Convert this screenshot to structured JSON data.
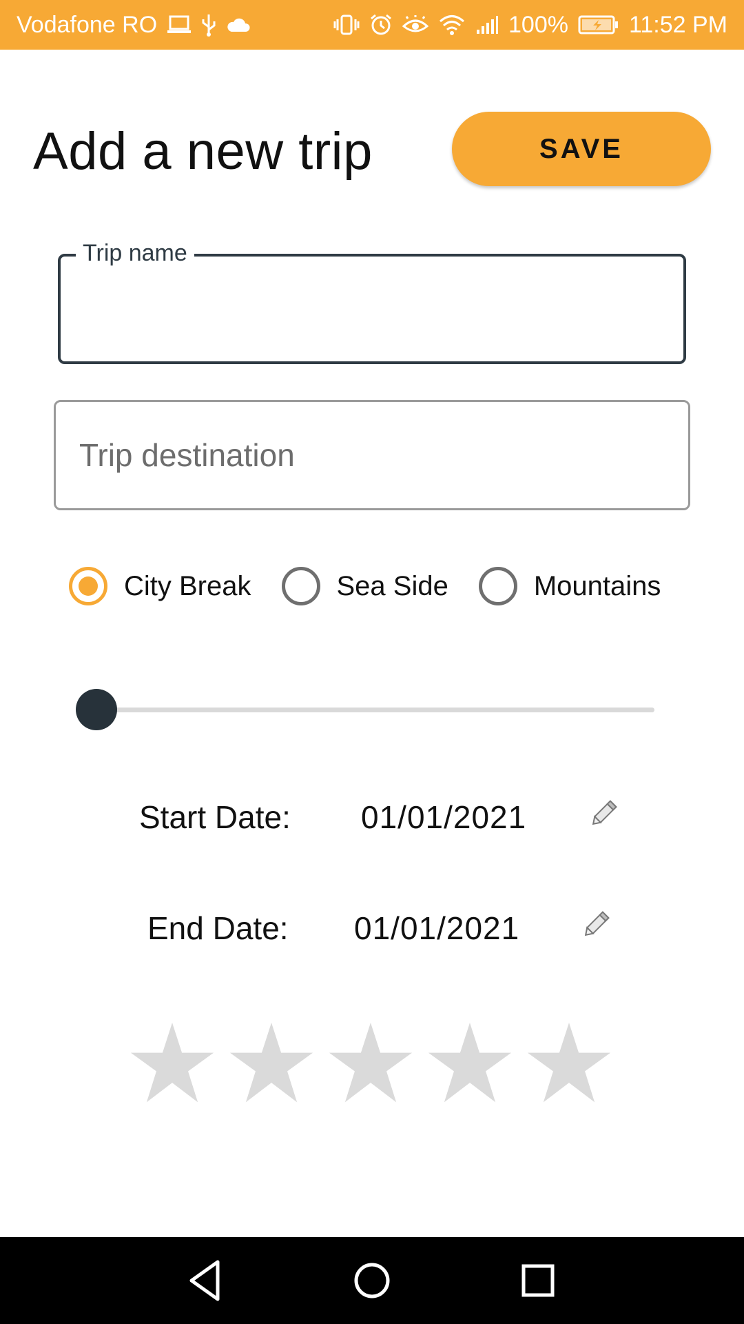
{
  "status_bar": {
    "carrier": "Vodafone RO",
    "battery": "100%",
    "time": "11:52 PM",
    "background_color": "#F7A935",
    "left_icons": [
      "laptop-icon",
      "usb-icon",
      "cloud-icon"
    ],
    "right_icons": [
      "vibrate-icon",
      "alarm-icon",
      "eye-comfort-icon",
      "wifi-icon",
      "signal-icon",
      "battery-charging-icon"
    ]
  },
  "header": {
    "title": "Add a new trip",
    "save_label": "SAVE",
    "accent_color": "#F7A935"
  },
  "form": {
    "trip_name": {
      "label": "Trip name",
      "value": ""
    },
    "trip_destination": {
      "placeholder": "Trip destination",
      "value": ""
    },
    "trip_type": {
      "options": [
        "City Break",
        "Sea Side",
        "Mountains"
      ],
      "selected": "City Break"
    },
    "slider": {
      "value_fraction": 0
    },
    "start_date": {
      "label": "Start Date:",
      "value": "01/01/2021",
      "icon": "pencil-icon"
    },
    "end_date": {
      "label": "End Date:",
      "value": "01/01/2021",
      "icon": "pencil-icon"
    },
    "rating": {
      "max": 5,
      "value": 0,
      "empty_color": "#DADADA"
    }
  },
  "nav_bar": {
    "buttons": [
      "back-icon",
      "home-icon",
      "recents-icon"
    ]
  }
}
